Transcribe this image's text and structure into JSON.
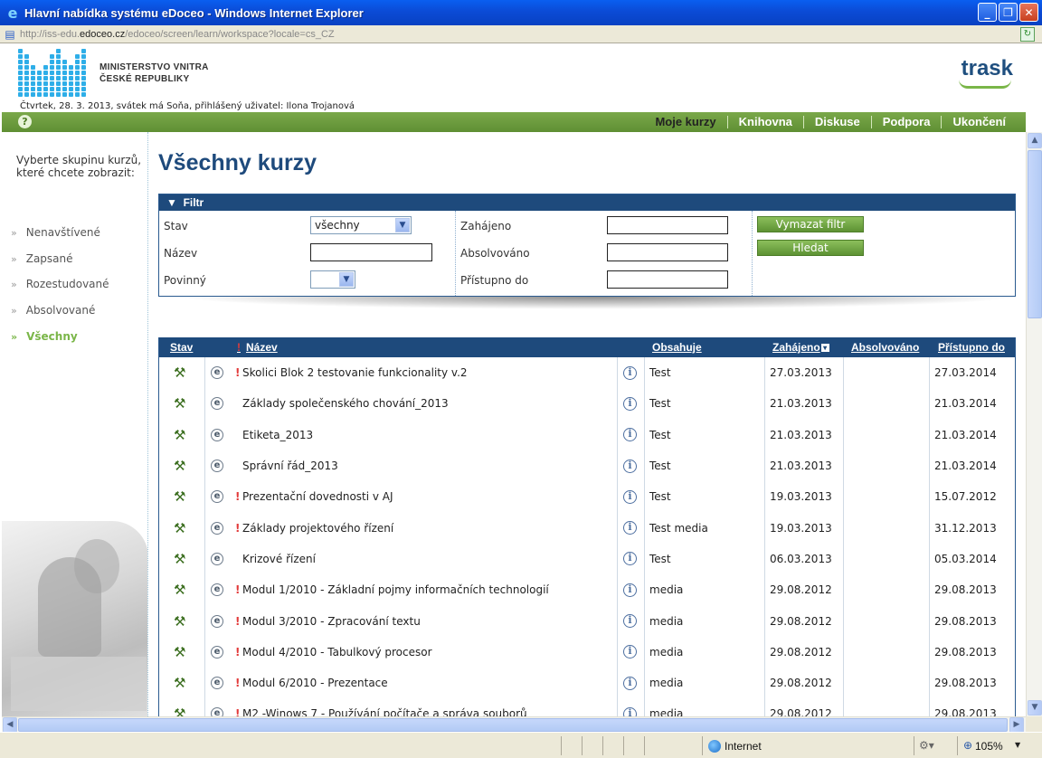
{
  "window": {
    "title": "Hlavní nabídka systému eDoceo - Windows Internet Explorer",
    "url_prefix": "http://iss-edu.",
    "url_domain": "edoceo.cz",
    "url_suffix": "/edoceo/screen/learn/workspace?locale=cs_CZ"
  },
  "header": {
    "ministry_line1": "MINISTERSTVO VNITRA",
    "ministry_line2": "ČESKÉ REPUBLIKY",
    "brand": "trask",
    "user_line": "Čtvrtek, 28. 3. 2013, svátek má Soňa, přihlášený uživatel: Ilona Trojanová"
  },
  "topnav": {
    "items": [
      "Moje kurzy",
      "Knihovna",
      "Diskuse",
      "Podpora",
      "Ukončení"
    ]
  },
  "sidebar": {
    "prompt": "Vyberte skupinu kurzů, které chcete zobrazit:",
    "items": [
      "Nenavštívené",
      "Zapsané",
      "Rozestudované",
      "Absolvované",
      "Všechny"
    ],
    "active_index": 4
  },
  "page": {
    "title": "Všechny kurzy"
  },
  "filter": {
    "heading": "Filtr",
    "stav_label": "Stav",
    "stav_value": "všechny",
    "nazev_label": "Název",
    "nazev_value": "",
    "povinny_label": "Povinný",
    "povinny_value": "",
    "zahajeno_label": "Zahájeno",
    "zahajeno_value": "",
    "absolvovano_label": "Absolvováno",
    "absolvovano_value": "",
    "pristupno_label": "Přístupno do",
    "pristupno_value": "",
    "clear_button": "Vymazat filtr",
    "search_button": "Hledat"
  },
  "table": {
    "headers": {
      "stav": "Stav",
      "required_mark": "!",
      "nazev": "Název",
      "obsahuje": "Obsahuje",
      "zahajeno": "Zahájeno",
      "absolvovano": "Absolvováno",
      "pristupno": "Přístupno do"
    },
    "rows": [
      {
        "required": "!",
        "name": "Skolici Blok 2 testovanie funkcionality v.2",
        "contains": "Test",
        "started": "27.03.2013",
        "completed": "",
        "available": "27.03.2014"
      },
      {
        "required": "",
        "name": "Základy společenského chování_2013",
        "contains": "Test",
        "started": "21.03.2013",
        "completed": "",
        "available": "21.03.2014"
      },
      {
        "required": "",
        "name": "Etiketa_2013",
        "contains": "Test",
        "started": "21.03.2013",
        "completed": "",
        "available": "21.03.2014"
      },
      {
        "required": "",
        "name": "Správní řád_2013",
        "contains": "Test",
        "started": "21.03.2013",
        "completed": "",
        "available": "21.03.2014"
      },
      {
        "required": "!",
        "name": "Prezentační dovednosti v AJ",
        "contains": "Test",
        "started": "19.03.2013",
        "completed": "",
        "available": "15.07.2012"
      },
      {
        "required": "!",
        "name": "Základy projektového řízení",
        "contains": "Test media",
        "started": "19.03.2013",
        "completed": "",
        "available": "31.12.2013"
      },
      {
        "required": "",
        "name": "Krizové řízení",
        "contains": "Test",
        "started": "06.03.2013",
        "completed": "",
        "available": "05.03.2014"
      },
      {
        "required": "!",
        "name": "Modul 1/2010 - Základní pojmy informačních technologií",
        "contains": "media",
        "started": "29.08.2012",
        "completed": "",
        "available": "29.08.2013"
      },
      {
        "required": "!",
        "name": "Modul 3/2010 - Zpracování textu",
        "contains": "media",
        "started": "29.08.2012",
        "completed": "",
        "available": "29.08.2013"
      },
      {
        "required": "!",
        "name": "Modul 4/2010 - Tabulkový procesor",
        "contains": "media",
        "started": "29.08.2012",
        "completed": "",
        "available": "29.08.2013"
      },
      {
        "required": "!",
        "name": "Modul 6/2010 - Prezentace",
        "contains": "media",
        "started": "29.08.2012",
        "completed": "",
        "available": "29.08.2013"
      },
      {
        "required": "!",
        "name": "M2 -Winows 7 - Používání počítače a správa souborů",
        "contains": "media",
        "started": "29.08.2012",
        "completed": "",
        "available": "29.08.2013"
      }
    ]
  },
  "statusbar": {
    "zone": "Internet",
    "zoom": "105%"
  }
}
